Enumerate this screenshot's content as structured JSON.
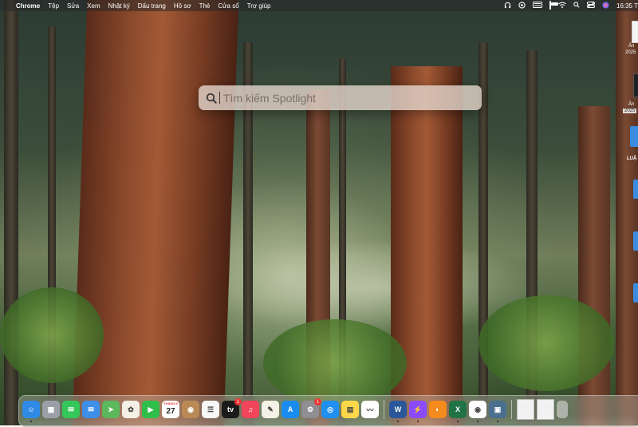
{
  "menubar": {
    "apple_glyph": "",
    "app_name": "Chrome",
    "menus": [
      "Tệp",
      "Sửa",
      "Xem",
      "Nhật ký",
      "Dấu trang",
      "Hồ sơ",
      "Thẻ",
      "Cửa sổ",
      "Trợ giúp"
    ],
    "status_icons": [
      "headphones-icon",
      "vpn-icon",
      "keyboard-input-icon",
      "battery-icon",
      "wifi-icon",
      "search-icon",
      "control-center-icon",
      "siri-icon"
    ],
    "clock": "16:35 T"
  },
  "spotlight": {
    "placeholder": "Tìm kiếm Spotlight",
    "value": ""
  },
  "desktop": {
    "items": [
      {
        "label": "Ản",
        "date": "2025"
      },
      {
        "label": "Ản",
        "date": "2025"
      },
      {
        "label": "LUẬ"
      }
    ]
  },
  "dock": {
    "apps": [
      {
        "name": "finder",
        "color": "#2f8ae6",
        "glyph": "☺",
        "running": true
      },
      {
        "name": "launchpad",
        "color": "#9b9fa8",
        "glyph": "▦",
        "running": false
      },
      {
        "name": "messages",
        "color": "#35c759",
        "glyph": "✉",
        "running": false
      },
      {
        "name": "mail",
        "color": "#3d8fe8",
        "glyph": "✉",
        "running": false
      },
      {
        "name": "maps",
        "color": "#5cb85c",
        "glyph": "➤",
        "running": false
      },
      {
        "name": "photos",
        "color": "#f5f0e6",
        "glyph": "✿",
        "running": false
      },
      {
        "name": "facetime",
        "color": "#2fbe4a",
        "glyph": "▶",
        "running": false
      },
      {
        "name": "calendar",
        "color": "#ffffff",
        "glyph": "27",
        "month": "THÁNG 5",
        "running": false
      },
      {
        "name": "contacts",
        "color": "#b98a55",
        "glyph": "◉",
        "running": false
      },
      {
        "name": "reminders",
        "color": "#f7f7f7",
        "glyph": "☰",
        "running": false
      },
      {
        "name": "tv",
        "color": "#1b1b1b",
        "glyph": "tv",
        "badge": "1",
        "running": false
      },
      {
        "name": "music",
        "color": "#f0455a",
        "glyph": "♫",
        "running": false
      },
      {
        "name": "pages",
        "color": "#f4f1e6",
        "glyph": "✎",
        "running": false
      },
      {
        "name": "app-store",
        "color": "#1a8cf0",
        "glyph": "A",
        "running": false
      },
      {
        "name": "system-settings",
        "color": "#8e8e93",
        "glyph": "⚙",
        "badge": "1",
        "running": false
      },
      {
        "name": "safari",
        "color": "#1f8ff0",
        "glyph": "◎",
        "running": false
      },
      {
        "name": "notes",
        "color": "#ffd84a",
        "glyph": "▤",
        "running": false
      },
      {
        "name": "freeform",
        "color": "#ffffff",
        "glyph": "〰",
        "running": false
      },
      {
        "name": "word",
        "color": "#2b579a",
        "glyph": "W",
        "running": true
      },
      {
        "name": "messenger",
        "color": "#8a4bff",
        "glyph": "⚡",
        "running": true
      },
      {
        "name": "zalo-firefox",
        "color": "#f58a1f",
        "glyph": "◐",
        "running": false
      },
      {
        "name": "excel",
        "color": "#217346",
        "glyph": "X",
        "running": true
      },
      {
        "name": "chrome",
        "color": "#ffffff",
        "glyph": "◉",
        "running": true
      },
      {
        "name": "preview",
        "color": "#4a6f8f",
        "glyph": "▣",
        "running": true
      }
    ],
    "recent_docs": [
      "document-thumbnail-1",
      "document-thumbnail-2"
    ],
    "trash": "trash-icon"
  }
}
